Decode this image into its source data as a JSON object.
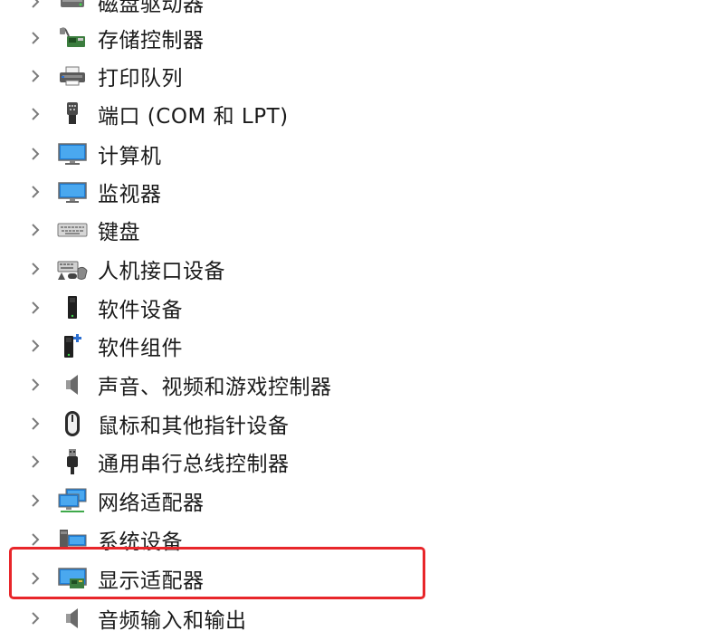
{
  "tree": {
    "items": [
      {
        "label": "磁盘驱动器",
        "icon": "disk-drive-icon"
      },
      {
        "label": "存储控制器",
        "icon": "storage-controller-icon"
      },
      {
        "label": "打印队列",
        "icon": "printer-icon"
      },
      {
        "label": "端口 (COM 和 LPT)",
        "icon": "port-icon"
      },
      {
        "label": "计算机",
        "icon": "computer-icon"
      },
      {
        "label": "监视器",
        "icon": "monitor-icon"
      },
      {
        "label": "键盘",
        "icon": "keyboard-icon"
      },
      {
        "label": "人机接口设备",
        "icon": "hid-icon"
      },
      {
        "label": "软件设备",
        "icon": "software-device-icon"
      },
      {
        "label": "软件组件",
        "icon": "software-component-icon"
      },
      {
        "label": "声音、视频和游戏控制器",
        "icon": "speaker-icon"
      },
      {
        "label": "鼠标和其他指针设备",
        "icon": "mouse-icon"
      },
      {
        "label": "通用串行总线控制器",
        "icon": "usb-icon"
      },
      {
        "label": "网络适配器",
        "icon": "network-adapter-icon"
      },
      {
        "label": "系统设备",
        "icon": "system-device-icon"
      },
      {
        "label": "显示适配器",
        "icon": "display-adapter-icon"
      },
      {
        "label": "音频输入和输出",
        "icon": "audio-io-icon"
      }
    ]
  },
  "colors": {
    "highlight": "#e8262a",
    "chevron": "#7a7a7a",
    "text": "#1b1b1b"
  }
}
